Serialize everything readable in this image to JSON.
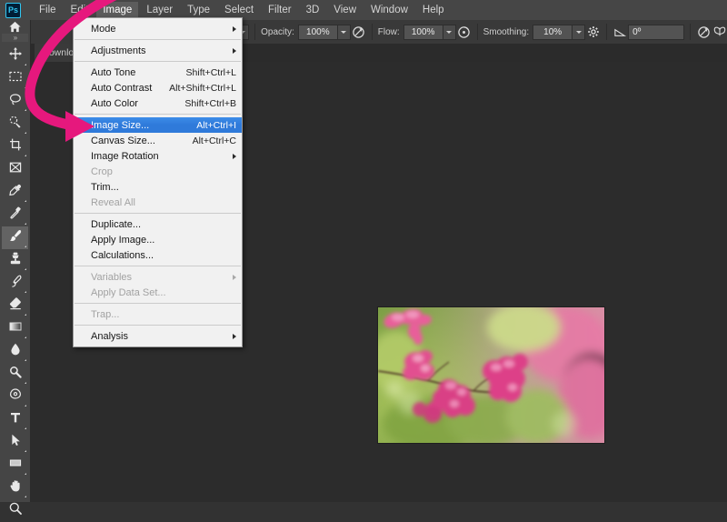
{
  "app": {
    "name": "Adobe Photoshop",
    "logo_text": "Ps",
    "accent_pink": "#e6187d",
    "highlight_blue": "#2f7ada",
    "menu_bg": "#f1f1f1",
    "chrome_bg": "#464646",
    "canvas_bg": "#2c2c2c"
  },
  "menubar": {
    "items": [
      {
        "label": "File",
        "active": false
      },
      {
        "label": "Edit",
        "active": false
      },
      {
        "label": "Image",
        "active": true
      },
      {
        "label": "Layer",
        "active": false
      },
      {
        "label": "Type",
        "active": false
      },
      {
        "label": "Select",
        "active": false
      },
      {
        "label": "Filter",
        "active": false
      },
      {
        "label": "3D",
        "active": false
      },
      {
        "label": "View",
        "active": false
      },
      {
        "label": "Window",
        "active": false
      },
      {
        "label": "Help",
        "active": false
      }
    ]
  },
  "options_bar": {
    "opacity_label": "Opacity:",
    "opacity_value": "100%",
    "flow_label": "Flow:",
    "flow_value": "100%",
    "smoothing_label": "Smoothing:",
    "smoothing_value": "10%",
    "angle_value": "0º",
    "brush_preset_value": "",
    "icons": [
      "airbrush-icon",
      "pressure-opacity-icon",
      "smoothing-options-gear-icon",
      "brush-angle-icon",
      "pressure-size-icon",
      "symmetry-butterfly-icon"
    ]
  },
  "document_tab": {
    "title": "downlo"
  },
  "toolbar": {
    "home_icon": "home-icon",
    "collapse_icon": "double-chevron-right-icon",
    "tools": [
      {
        "name": "move-tool",
        "icon": "move-arrows-icon",
        "selected": false,
        "has_flyout": true
      },
      {
        "name": "rectangular-marquee-tool",
        "icon": "marquee-rect-icon",
        "selected": false,
        "has_flyout": true
      },
      {
        "name": "lasso-tool",
        "icon": "lasso-icon",
        "selected": false,
        "has_flyout": true
      },
      {
        "name": "object-selection-tool",
        "icon": "quick-selection-icon",
        "selected": false,
        "has_flyout": true
      },
      {
        "name": "crop-tool",
        "icon": "crop-icon",
        "selected": false,
        "has_flyout": true
      },
      {
        "name": "frame-tool",
        "icon": "frame-icon",
        "selected": false,
        "has_flyout": false
      },
      {
        "name": "eyedropper-tool",
        "icon": "eyedropper-icon",
        "selected": false,
        "has_flyout": true
      },
      {
        "name": "spot-healing-brush-tool",
        "icon": "healing-brush-icon",
        "selected": false,
        "has_flyout": true
      },
      {
        "name": "brush-tool",
        "icon": "paint-brush-icon",
        "selected": true,
        "has_flyout": true
      },
      {
        "name": "clone-stamp-tool",
        "icon": "clone-stamp-icon",
        "selected": false,
        "has_flyout": true
      },
      {
        "name": "history-brush-tool",
        "icon": "history-brush-icon",
        "selected": false,
        "has_flyout": true
      },
      {
        "name": "eraser-tool",
        "icon": "eraser-icon",
        "selected": false,
        "has_flyout": true
      },
      {
        "name": "gradient-tool",
        "icon": "gradient-icon",
        "selected": false,
        "has_flyout": true
      },
      {
        "name": "blur-tool",
        "icon": "blur-droplet-icon",
        "selected": false,
        "has_flyout": true
      },
      {
        "name": "dodge-tool",
        "icon": "dodge-icon",
        "selected": false,
        "has_flyout": true
      },
      {
        "name": "pen-tool",
        "icon": "pen-icon",
        "selected": false,
        "has_flyout": true
      },
      {
        "name": "horizontal-type-tool",
        "icon": "type-t-icon",
        "selected": false,
        "has_flyout": true
      },
      {
        "name": "path-selection-tool",
        "icon": "path-arrow-icon",
        "selected": false,
        "has_flyout": true
      },
      {
        "name": "rectangle-tool",
        "icon": "rectangle-shape-icon",
        "selected": false,
        "has_flyout": true
      },
      {
        "name": "hand-tool",
        "icon": "hand-icon",
        "selected": false,
        "has_flyout": true
      },
      {
        "name": "zoom-tool",
        "icon": "magnifier-icon",
        "selected": false,
        "has_flyout": false
      }
    ]
  },
  "image_menu": {
    "groups": [
      [
        {
          "label": "Mode",
          "shortcut": "",
          "submenu": true,
          "disabled": false,
          "highlighted": false
        }
      ],
      [
        {
          "label": "Adjustments",
          "shortcut": "",
          "submenu": true,
          "disabled": false,
          "highlighted": false
        }
      ],
      [
        {
          "label": "Auto Tone",
          "shortcut": "Shift+Ctrl+L",
          "submenu": false,
          "disabled": false,
          "highlighted": false
        },
        {
          "label": "Auto Contrast",
          "shortcut": "Alt+Shift+Ctrl+L",
          "submenu": false,
          "disabled": false,
          "highlighted": false
        },
        {
          "label": "Auto Color",
          "shortcut": "Shift+Ctrl+B",
          "submenu": false,
          "disabled": false,
          "highlighted": false
        }
      ],
      [
        {
          "label": "Image Size...",
          "shortcut": "Alt+Ctrl+I",
          "submenu": false,
          "disabled": false,
          "highlighted": true
        },
        {
          "label": "Canvas Size...",
          "shortcut": "Alt+Ctrl+C",
          "submenu": false,
          "disabled": false,
          "highlighted": false
        },
        {
          "label": "Image Rotation",
          "shortcut": "",
          "submenu": true,
          "disabled": false,
          "highlighted": false
        },
        {
          "label": "Crop",
          "shortcut": "",
          "submenu": false,
          "disabled": true,
          "highlighted": false
        },
        {
          "label": "Trim...",
          "shortcut": "",
          "submenu": false,
          "disabled": false,
          "highlighted": false
        },
        {
          "label": "Reveal All",
          "shortcut": "",
          "submenu": false,
          "disabled": true,
          "highlighted": false
        }
      ],
      [
        {
          "label": "Duplicate...",
          "shortcut": "",
          "submenu": false,
          "disabled": false,
          "highlighted": false
        },
        {
          "label": "Apply Image...",
          "shortcut": "",
          "submenu": false,
          "disabled": false,
          "highlighted": false
        },
        {
          "label": "Calculations...",
          "shortcut": "",
          "submenu": false,
          "disabled": false,
          "highlighted": false
        }
      ],
      [
        {
          "label": "Variables",
          "shortcut": "",
          "submenu": true,
          "disabled": true,
          "highlighted": false
        },
        {
          "label": "Apply Data Set...",
          "shortcut": "",
          "submenu": false,
          "disabled": true,
          "highlighted": false
        }
      ],
      [
        {
          "label": "Trap...",
          "shortcut": "",
          "submenu": false,
          "disabled": true,
          "highlighted": false
        }
      ],
      [
        {
          "label": "Analysis",
          "shortcut": "",
          "submenu": true,
          "disabled": false,
          "highlighted": false
        }
      ]
    ]
  },
  "annotation": {
    "type": "curved-arrow",
    "color": "#e6187d",
    "points_to": "Image Size..."
  },
  "document": {
    "photo_description": "pink coral vine flowers on a branch with blurred green and pink bokeh background"
  }
}
